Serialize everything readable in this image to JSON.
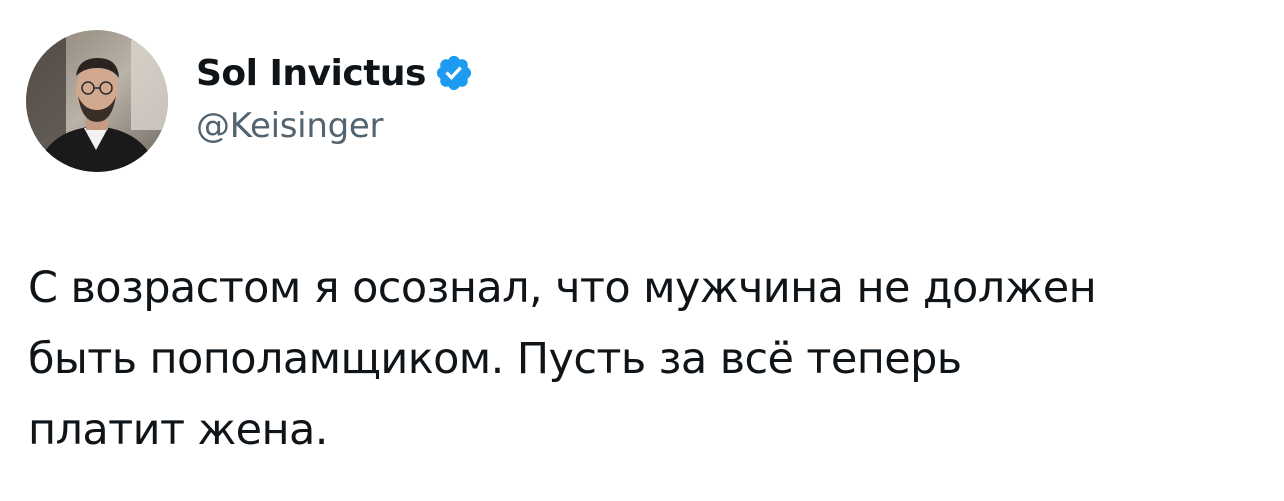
{
  "author": {
    "display_name": "Sol Invictus",
    "handle": "@Keisinger",
    "verified": true,
    "avatar_icon": "profile-photo",
    "verified_icon": "verified-badge-icon"
  },
  "tweet": {
    "text": "С возрастом я осознал, что мужчина не должен\nбыть пополамщиком. Пусть за всё теперь\nплатит жена."
  },
  "colors": {
    "text_primary": "#0f1419",
    "text_secondary": "#536471",
    "verified_blue": "#1d9bf0",
    "background": "#ffffff"
  }
}
